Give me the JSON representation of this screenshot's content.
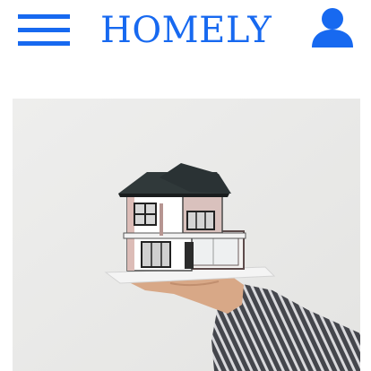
{
  "header": {
    "brand": "HOMELY",
    "menu_icon": "hamburger-menu-icon",
    "account_icon": "user-account-icon",
    "accent_color": "#1769f0"
  },
  "hero": {
    "image_subject": "model-house-on-hand"
  }
}
